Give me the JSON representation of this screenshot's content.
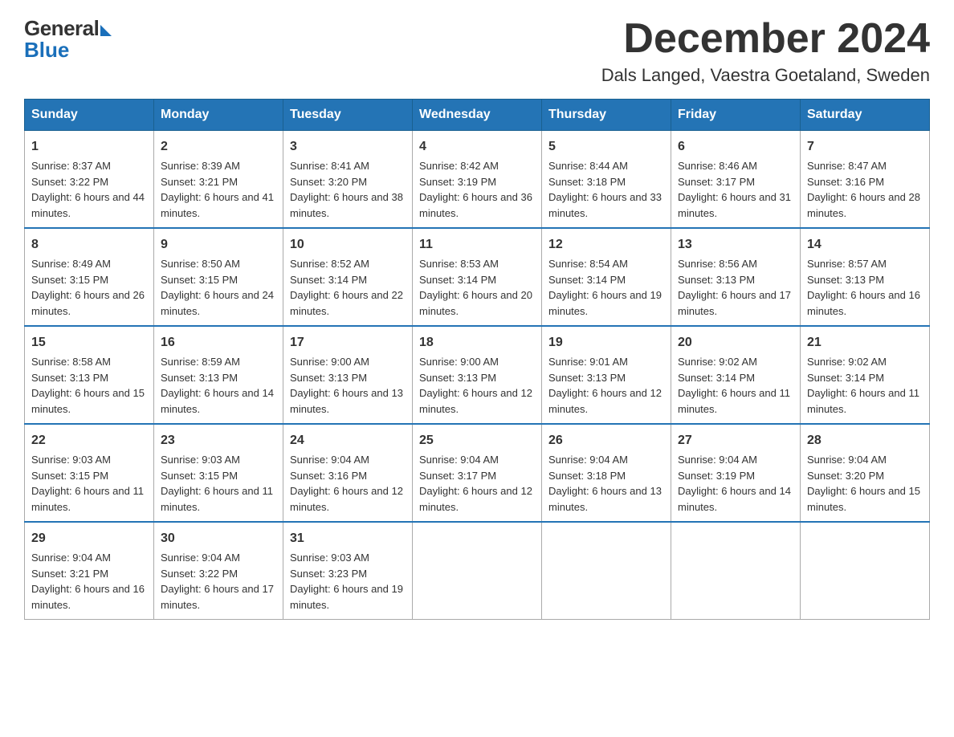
{
  "logo": {
    "text_general": "General",
    "text_blue": "Blue"
  },
  "header": {
    "month_title": "December 2024",
    "location": "Dals Langed, Vaestra Goetaland, Sweden"
  },
  "weekdays": [
    "Sunday",
    "Monday",
    "Tuesday",
    "Wednesday",
    "Thursday",
    "Friday",
    "Saturday"
  ],
  "weeks": [
    [
      {
        "day": "1",
        "sunrise": "8:37 AM",
        "sunset": "3:22 PM",
        "daylight": "6 hours and 44 minutes."
      },
      {
        "day": "2",
        "sunrise": "8:39 AM",
        "sunset": "3:21 PM",
        "daylight": "6 hours and 41 minutes."
      },
      {
        "day": "3",
        "sunrise": "8:41 AM",
        "sunset": "3:20 PM",
        "daylight": "6 hours and 38 minutes."
      },
      {
        "day": "4",
        "sunrise": "8:42 AM",
        "sunset": "3:19 PM",
        "daylight": "6 hours and 36 minutes."
      },
      {
        "day": "5",
        "sunrise": "8:44 AM",
        "sunset": "3:18 PM",
        "daylight": "6 hours and 33 minutes."
      },
      {
        "day": "6",
        "sunrise": "8:46 AM",
        "sunset": "3:17 PM",
        "daylight": "6 hours and 31 minutes."
      },
      {
        "day": "7",
        "sunrise": "8:47 AM",
        "sunset": "3:16 PM",
        "daylight": "6 hours and 28 minutes."
      }
    ],
    [
      {
        "day": "8",
        "sunrise": "8:49 AM",
        "sunset": "3:15 PM",
        "daylight": "6 hours and 26 minutes."
      },
      {
        "day": "9",
        "sunrise": "8:50 AM",
        "sunset": "3:15 PM",
        "daylight": "6 hours and 24 minutes."
      },
      {
        "day": "10",
        "sunrise": "8:52 AM",
        "sunset": "3:14 PM",
        "daylight": "6 hours and 22 minutes."
      },
      {
        "day": "11",
        "sunrise": "8:53 AM",
        "sunset": "3:14 PM",
        "daylight": "6 hours and 20 minutes."
      },
      {
        "day": "12",
        "sunrise": "8:54 AM",
        "sunset": "3:14 PM",
        "daylight": "6 hours and 19 minutes."
      },
      {
        "day": "13",
        "sunrise": "8:56 AM",
        "sunset": "3:13 PM",
        "daylight": "6 hours and 17 minutes."
      },
      {
        "day": "14",
        "sunrise": "8:57 AM",
        "sunset": "3:13 PM",
        "daylight": "6 hours and 16 minutes."
      }
    ],
    [
      {
        "day": "15",
        "sunrise": "8:58 AM",
        "sunset": "3:13 PM",
        "daylight": "6 hours and 15 minutes."
      },
      {
        "day": "16",
        "sunrise": "8:59 AM",
        "sunset": "3:13 PM",
        "daylight": "6 hours and 14 minutes."
      },
      {
        "day": "17",
        "sunrise": "9:00 AM",
        "sunset": "3:13 PM",
        "daylight": "6 hours and 13 minutes."
      },
      {
        "day": "18",
        "sunrise": "9:00 AM",
        "sunset": "3:13 PM",
        "daylight": "6 hours and 12 minutes."
      },
      {
        "day": "19",
        "sunrise": "9:01 AM",
        "sunset": "3:13 PM",
        "daylight": "6 hours and 12 minutes."
      },
      {
        "day": "20",
        "sunrise": "9:02 AM",
        "sunset": "3:14 PM",
        "daylight": "6 hours and 11 minutes."
      },
      {
        "day": "21",
        "sunrise": "9:02 AM",
        "sunset": "3:14 PM",
        "daylight": "6 hours and 11 minutes."
      }
    ],
    [
      {
        "day": "22",
        "sunrise": "9:03 AM",
        "sunset": "3:15 PM",
        "daylight": "6 hours and 11 minutes."
      },
      {
        "day": "23",
        "sunrise": "9:03 AM",
        "sunset": "3:15 PM",
        "daylight": "6 hours and 11 minutes."
      },
      {
        "day": "24",
        "sunrise": "9:04 AM",
        "sunset": "3:16 PM",
        "daylight": "6 hours and 12 minutes."
      },
      {
        "day": "25",
        "sunrise": "9:04 AM",
        "sunset": "3:17 PM",
        "daylight": "6 hours and 12 minutes."
      },
      {
        "day": "26",
        "sunrise": "9:04 AM",
        "sunset": "3:18 PM",
        "daylight": "6 hours and 13 minutes."
      },
      {
        "day": "27",
        "sunrise": "9:04 AM",
        "sunset": "3:19 PM",
        "daylight": "6 hours and 14 minutes."
      },
      {
        "day": "28",
        "sunrise": "9:04 AM",
        "sunset": "3:20 PM",
        "daylight": "6 hours and 15 minutes."
      }
    ],
    [
      {
        "day": "29",
        "sunrise": "9:04 AM",
        "sunset": "3:21 PM",
        "daylight": "6 hours and 16 minutes."
      },
      {
        "day": "30",
        "sunrise": "9:04 AM",
        "sunset": "3:22 PM",
        "daylight": "6 hours and 17 minutes."
      },
      {
        "day": "31",
        "sunrise": "9:03 AM",
        "sunset": "3:23 PM",
        "daylight": "6 hours and 19 minutes."
      },
      null,
      null,
      null,
      null
    ]
  ]
}
